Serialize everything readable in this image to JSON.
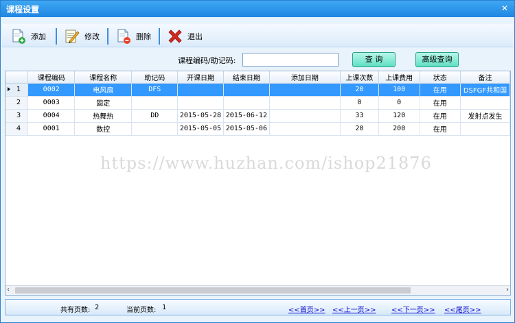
{
  "window": {
    "title": "课程设置"
  },
  "toolbar": {
    "add_label": "添加",
    "edit_label": "修改",
    "delete_label": "删除",
    "exit_label": "退出"
  },
  "search": {
    "label": "课程编码/助记码:",
    "value": "",
    "query_label": "查 询",
    "advanced_label": "高级查询"
  },
  "table": {
    "columns": [
      "课程编码",
      "课程名称",
      "助记码",
      "开课日期",
      "结束日期",
      "添加日期",
      "上课次数",
      "上课费用",
      "状态",
      "备注"
    ],
    "rows": [
      {
        "index": "1",
        "code": "0002",
        "name": "电风扇",
        "mnemonic": "DFS",
        "start": "",
        "end": "",
        "added": "",
        "count": "20",
        "fee": "100",
        "status": "在用",
        "note": "DSFGF共和国"
      },
      {
        "index": "2",
        "code": "0003",
        "name": "固定",
        "mnemonic": "",
        "start": "",
        "end": "",
        "added": "",
        "count": "0",
        "fee": "0",
        "status": "在用",
        "note": ""
      },
      {
        "index": "3",
        "code": "0004",
        "name": "热舞热",
        "mnemonic": "DD",
        "start": "2015-05-28",
        "end": "2015-06-12",
        "added": "",
        "count": "33",
        "fee": "120",
        "status": "在用",
        "note": "发射点发生"
      },
      {
        "index": "4",
        "code": "0001",
        "name": "数控",
        "mnemonic": "",
        "start": "2015-05-05",
        "end": "2015-05-06",
        "added": "",
        "count": "20",
        "fee": "200",
        "status": "在用",
        "note": ""
      }
    ]
  },
  "watermark": "https://www.huzhan.com/ishop21876",
  "status": {
    "total_pages_label": "共有页数:",
    "total_pages": "2",
    "current_page_label": "当前页数:",
    "current_page": "1",
    "first": "<<首页>>",
    "prev": "<<上一页>>",
    "next": "<<下一页>>",
    "last": "<<尾页>>"
  }
}
